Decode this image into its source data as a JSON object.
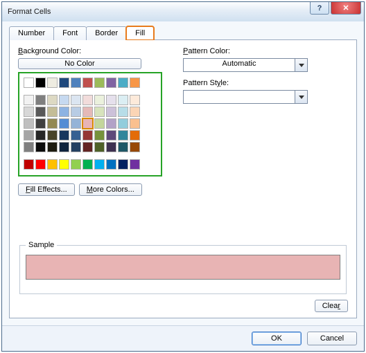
{
  "window": {
    "title": "Format Cells"
  },
  "tabs": {
    "t0": "Number",
    "t1": "Font",
    "t2": "Border",
    "t3": "Fill"
  },
  "left": {
    "bg_label": "Background Color:",
    "no_color": "No Color",
    "fill_effects": "Fill Effects...",
    "more_colors": "More Colors..."
  },
  "right": {
    "pattern_color_label": "Pattern Color:",
    "pattern_color_value": "Automatic",
    "pattern_style_label": "Pattern Style:",
    "pattern_style_value": ""
  },
  "sample": {
    "legend": "Sample",
    "color": "#e8b4b4"
  },
  "buttons": {
    "clear": "Clear",
    "ok": "OK",
    "cancel": "Cancel"
  },
  "swatches": {
    "theme1": [
      "#ffffff",
      "#000000",
      "#eeece1",
      "#1f497d",
      "#4f81bd",
      "#c0504d",
      "#9bbb59",
      "#8064a2",
      "#4bacc6",
      "#f79646"
    ],
    "grid": [
      [
        "#f2f2f2",
        "#7f7f7f",
        "#ddd9c3",
        "#c6d9f0",
        "#dbe5f1",
        "#f2dcdb",
        "#ebf1dd",
        "#e5e0ec",
        "#dbeef3",
        "#fdeada"
      ],
      [
        "#d8d8d8",
        "#595959",
        "#c4bd97",
        "#8db3e2",
        "#b8cce4",
        "#e5b9b7",
        "#d7e3bc",
        "#ccc1d9",
        "#b7dde8",
        "#fbd5b5"
      ],
      [
        "#bfbfbf",
        "#3f3f3f",
        "#938953",
        "#548dd4",
        "#95b3d7",
        "#e8b4b4",
        "#c3d69b",
        "#b2a2c7",
        "#92cddc",
        "#fac08f"
      ],
      [
        "#a5a5a5",
        "#262626",
        "#494429",
        "#17365d",
        "#366092",
        "#953734",
        "#76923c",
        "#5f497a",
        "#31859b",
        "#e36c09"
      ],
      [
        "#7f7f7f",
        "#0c0c0c",
        "#1d1b10",
        "#0f243e",
        "#244061",
        "#632423",
        "#4f6128",
        "#3f3151",
        "#205867",
        "#974806"
      ]
    ],
    "standard": [
      "#c00000",
      "#ff0000",
      "#ffc000",
      "#ffff00",
      "#92d050",
      "#00b050",
      "#00b0f0",
      "#0070c0",
      "#002060",
      "#7030a0"
    ],
    "selected": "#e8b4b4"
  }
}
